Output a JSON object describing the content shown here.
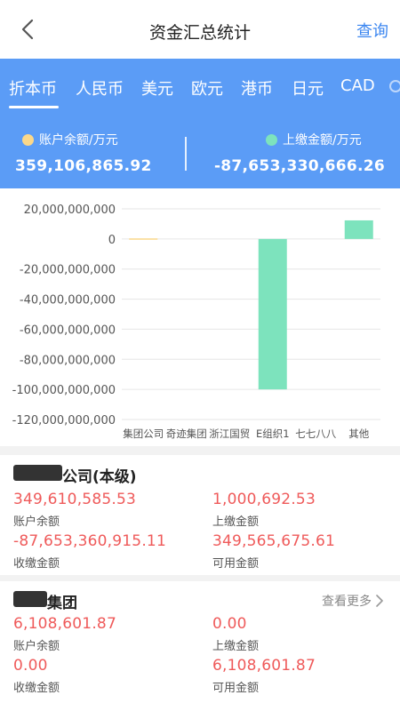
{
  "header": {
    "title": "资金汇总统计",
    "query_label": "查询",
    "back_icon": "chevron-left-icon"
  },
  "tabs": [
    {
      "label": "折本币",
      "active": true
    },
    {
      "label": "人民币"
    },
    {
      "label": "美元"
    },
    {
      "label": "欧元"
    },
    {
      "label": "港币"
    },
    {
      "label": "日元"
    },
    {
      "label": "CAD"
    }
  ],
  "summary": {
    "balance_label": "账户余额/万元",
    "balance_value": "359,106,865.92",
    "balance_color": "#fbd88a",
    "paid_label": "上缴金额/万元",
    "paid_value": "-87,653,330,666.26",
    "paid_color": "#7de3bd"
  },
  "chart_data": {
    "type": "bar",
    "categories": [
      "集团公司",
      "奇迹集团",
      "浙江国贸",
      "E组织1",
      "七七八八",
      "其他"
    ],
    "series": [
      {
        "color": "#fbd88a",
        "values": [
          359106865.92,
          0,
          0,
          0,
          0,
          0
        ]
      },
      {
        "color": "#7de3bd",
        "values": [
          0,
          0,
          0,
          -100000000000,
          0,
          12346669333.74
        ]
      }
    ],
    "ylim": [
      -120000000000,
      20000000000
    ],
    "yticks": [
      20000000000,
      0,
      -20000000000,
      -40000000000,
      -60000000000,
      -80000000000,
      -100000000000,
      -120000000000
    ],
    "ytick_labels": [
      "20,000,000,000",
      "0",
      "-20,000,000,000",
      "-40,000,000,000",
      "-60,000,000,000",
      "-80,000,000,000",
      "-100,000,000,000",
      "-120,000,000,000"
    ],
    "grid": true
  },
  "cards": [
    {
      "title": "公司(本级)",
      "show_more": false,
      "fields": [
        {
          "value": "349,610,585.53",
          "label": "账户余额"
        },
        {
          "value": "1,000,692.53",
          "label": "上缴金额"
        },
        {
          "value": "-87,653,360,915.11",
          "label": "收缴金额"
        },
        {
          "value": "349,565,675.61",
          "label": "可用金额"
        }
      ]
    },
    {
      "title": "集团",
      "show_more": true,
      "more_label": "查看更多",
      "fields": [
        {
          "value": "6,108,601.87",
          "label": "账户余额"
        },
        {
          "value": "0.00",
          "label": "上缴金额"
        },
        {
          "value": "0.00",
          "label": "收缴金额"
        },
        {
          "value": "6,108,601.87",
          "label": "可用金额"
        }
      ]
    }
  ]
}
